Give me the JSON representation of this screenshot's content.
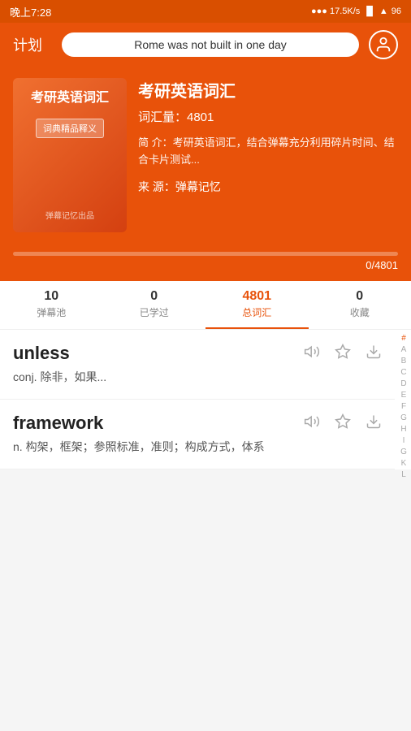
{
  "status": {
    "time": "晚上7:28",
    "network": "...●17.5K/s",
    "battery": "96"
  },
  "header": {
    "title": "计划",
    "search_text": "Rome was not built in one day",
    "avatar_icon": "👤"
  },
  "book": {
    "cover_title": "考研英语词汇",
    "cover_badge": "词典精品释义",
    "cover_brand": "弹幕记忆出品",
    "name": "考研英语词汇",
    "word_count_label": "词汇量：4801",
    "desc_label": "简  介：",
    "desc_text": "考研英语词汇，结合弹幕充分利用碎片时间、结合卡片测试...",
    "source_label": "来    源：弹幕记忆"
  },
  "progress": {
    "current": 0,
    "total": 4801,
    "text": "0/4801",
    "percent": 0
  },
  "tabs": [
    {
      "number": "10",
      "label": "弹幕池",
      "active": false
    },
    {
      "number": "0",
      "label": "已学过",
      "active": false
    },
    {
      "number": "4801",
      "label": "总词汇",
      "active": true
    },
    {
      "number": "0",
      "label": "收藏",
      "active": false
    }
  ],
  "words": [
    {
      "word": "unless",
      "definition": "conj. 除非，如果..."
    },
    {
      "word": "framework",
      "definition": "n. 构架，框架；参照标准，准则；构成方式，体系"
    }
  ],
  "alphabet": [
    "#",
    "A",
    "B",
    "C",
    "D",
    "E",
    "F",
    "G",
    "H",
    "I",
    "G",
    "K",
    "L"
  ]
}
